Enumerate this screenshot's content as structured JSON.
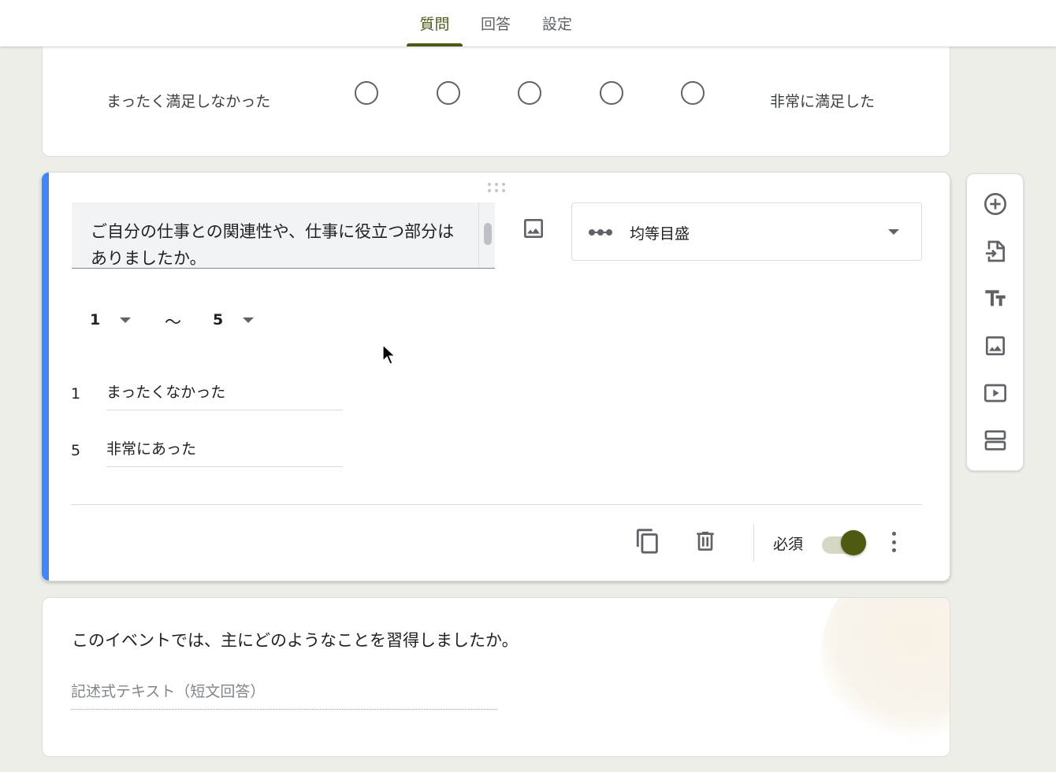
{
  "tabs": [
    {
      "label": "質問",
      "active": true
    },
    {
      "label": "回答",
      "active": false
    },
    {
      "label": "設定",
      "active": false
    }
  ],
  "colors": {
    "accent": "#4a5a14",
    "active_bar": "#4285f4",
    "toggle_on": "#4f5a10"
  },
  "prev_question": {
    "low_label": "まったく満足しなかった",
    "high_label": "非常に満足した",
    "scale_count": 5
  },
  "active_question": {
    "title": "ご自分の仕事との関連性や、仕事に役立つ部分はありましたか。",
    "type_label": "均等目盛",
    "type_icon": "linear-scale-icon",
    "range_min": "1",
    "range_sep": "〜",
    "range_max": "5",
    "labels": [
      {
        "num": "1",
        "text": "まったくなかった"
      },
      {
        "num": "5",
        "text": "非常にあった"
      }
    ],
    "required_label": "必須",
    "required": true
  },
  "next_question": {
    "title": "このイベントでは、主にどのようなことを習得しましたか。",
    "placeholder": "記述式テキスト（短文回答）"
  },
  "side_tools": [
    "add-question-icon",
    "import-questions-icon",
    "add-title-icon",
    "add-image-icon",
    "add-video-icon",
    "add-section-icon"
  ]
}
